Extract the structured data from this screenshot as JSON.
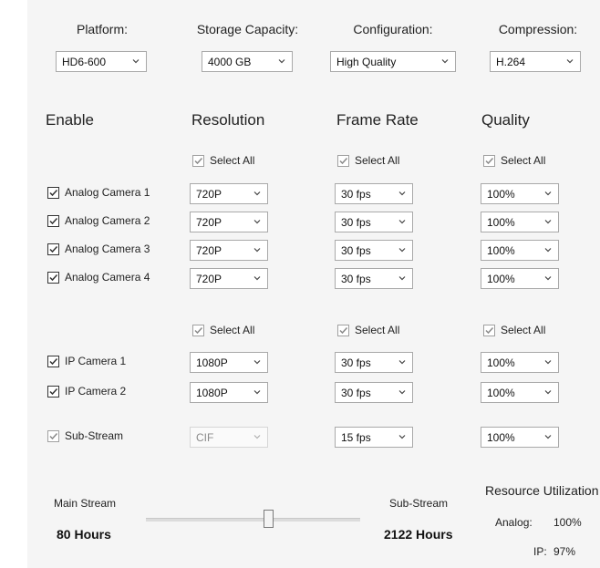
{
  "top": {
    "platform": {
      "label": "Platform:",
      "value": "HD6-600"
    },
    "storage": {
      "label": "Storage Capacity:",
      "value": "4000 GB"
    },
    "configuration": {
      "label": "Configuration:",
      "value": "High Quality"
    },
    "compression": {
      "label": "Compression:",
      "value": "H.264"
    }
  },
  "headers": {
    "enable": "Enable",
    "resolution": "Resolution",
    "frame_rate": "Frame Rate",
    "quality": "Quality"
  },
  "select_all": "Select All",
  "analog_cameras": [
    {
      "name": "Analog Camera 1",
      "resolution": "720P",
      "fps": "30 fps",
      "quality": "100%"
    },
    {
      "name": "Analog Camera 2",
      "resolution": "720P",
      "fps": "30 fps",
      "quality": "100%"
    },
    {
      "name": "Analog Camera 3",
      "resolution": "720P",
      "fps": "30 fps",
      "quality": "100%"
    },
    {
      "name": "Analog Camera 4",
      "resolution": "720P",
      "fps": "30 fps",
      "quality": "100%"
    }
  ],
  "ip_cameras": [
    {
      "name": "IP Camera 1",
      "resolution": "1080P",
      "fps": "30 fps",
      "quality": "100%"
    },
    {
      "name": "IP Camera 2",
      "resolution": "1080P",
      "fps": "30 fps",
      "quality": "100%"
    }
  ],
  "sub_stream": {
    "name": "Sub-Stream",
    "resolution": "CIF",
    "fps": "15 fps",
    "quality": "100%"
  },
  "bottom": {
    "main_stream_label": "Main Stream",
    "main_stream_hours": "80 Hours",
    "sub_stream_label": "Sub-Stream",
    "sub_stream_hours": "2122 Hours",
    "slider_fraction": 0.57
  },
  "resource": {
    "title": "Resource Utilization",
    "analog_label": "Analog:",
    "analog_value": "100%",
    "ip_label": "IP:",
    "ip_value": "97%"
  },
  "colors": {
    "panel_bg": "#f5f5f5",
    "border": "#a9a9a9",
    "check": "#333333"
  }
}
